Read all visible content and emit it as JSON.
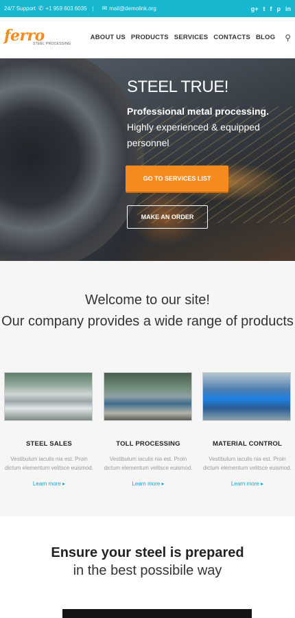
{
  "topbar": {
    "support_label": "24/7 Support",
    "phone": "+1 959 603 6035",
    "email": "mail@demolink.org",
    "social": [
      "g+",
      "t",
      "f",
      "p",
      "in"
    ]
  },
  "header": {
    "logo_text": "ferro",
    "logo_sub": "STEEL PROCESSING",
    "nav": [
      "ABOUT US",
      "PRODUCTS",
      "SERVICES",
      "CONTACTS",
      "BLOG"
    ]
  },
  "hero": {
    "title": "STEEL TRUE!",
    "lead_bold": "Professional metal processing.",
    "lead_text": "Highly experienced & equipped personnel",
    "primary_button": "GO TO SERVICES LIST",
    "secondary_button": "MAKE AN ORDER"
  },
  "welcome": {
    "line1": "Welcome to our site!",
    "line2": "Our company provides a wide range of products"
  },
  "cards": [
    {
      "title": "STEEL SALES",
      "text": "Vestibulum iaculis nia est. Proin dictum elementum velitsce euismod.",
      "link": "Learn more ▸"
    },
    {
      "title": "TOLL PROCESSING",
      "text": "Vestibulum iaculis nia est. Proin dictum elementum velitsce euismod.",
      "link": "Learn more ▸"
    },
    {
      "title": "MATERIAL CONTROL",
      "text": "Vestibulum iaculis nia est. Proin dictum elementum velitsce euismod.",
      "link": "Learn more ▸"
    }
  ],
  "ensure": {
    "heading": "Ensure your steel is prepared",
    "subheading": "in the best possibile way"
  },
  "colors": {
    "accent": "#f58a1f",
    "topbar": "#19b7cf",
    "link": "#1aa3c9"
  }
}
